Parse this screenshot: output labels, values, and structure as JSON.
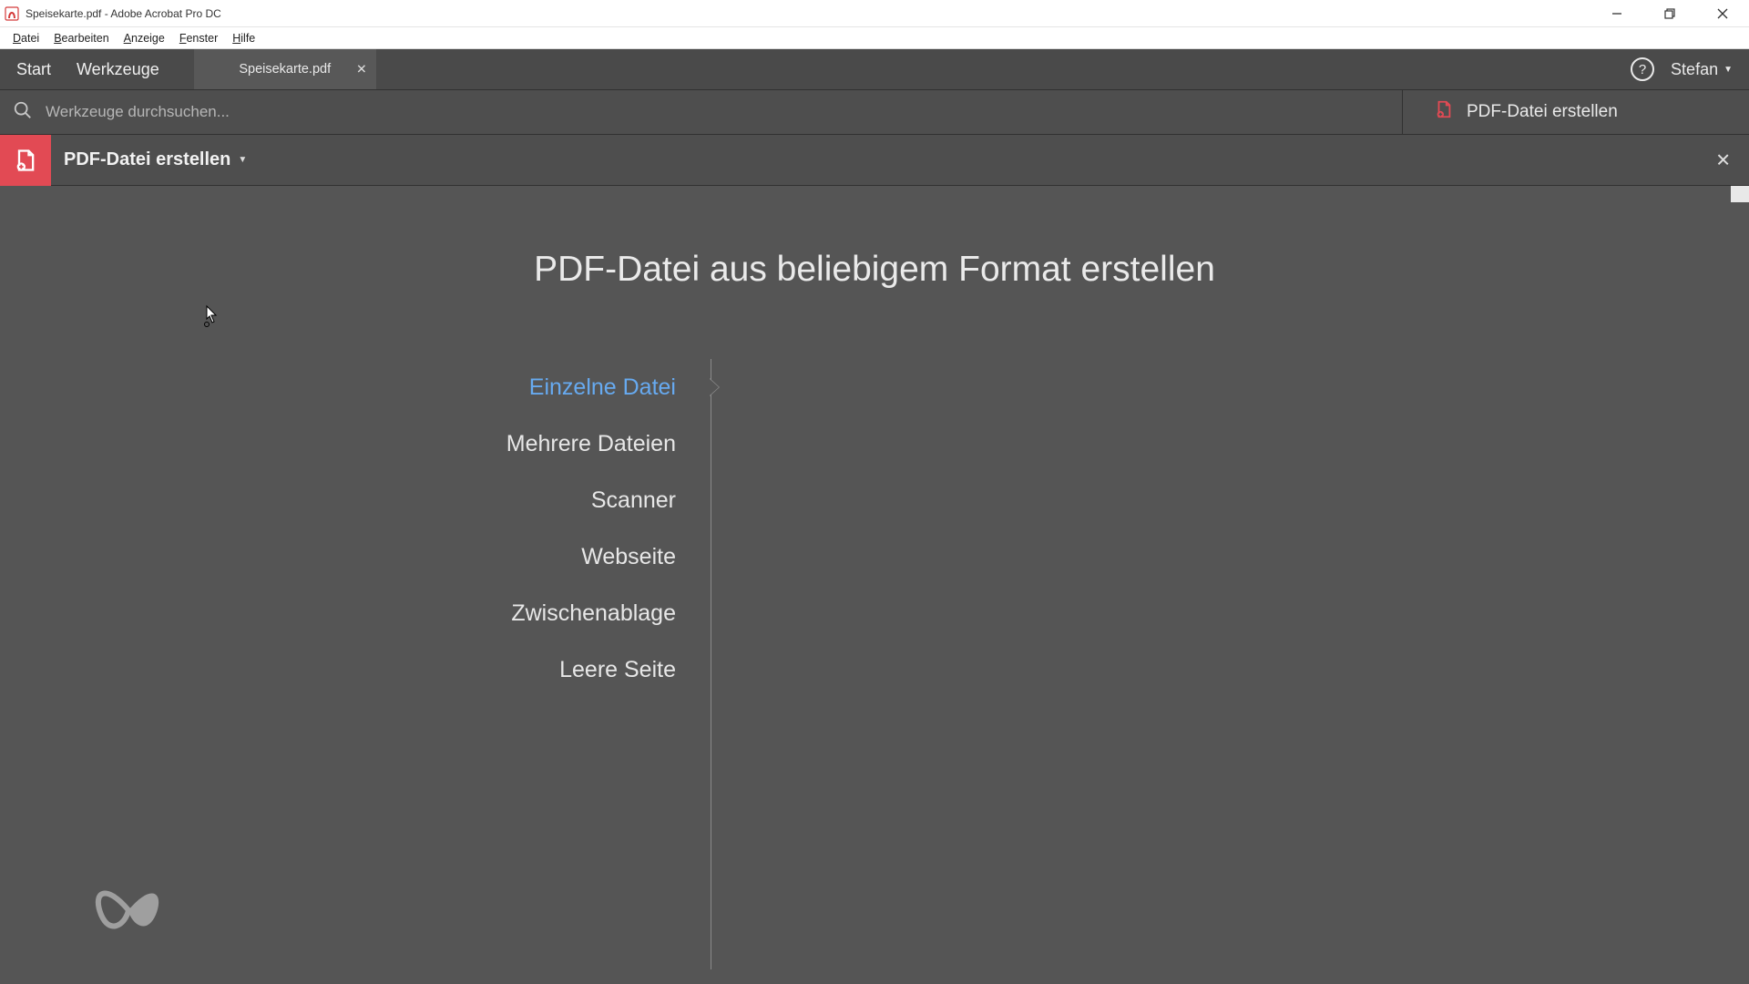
{
  "window": {
    "title": "Speisekarte.pdf - Adobe Acrobat Pro DC"
  },
  "menubar": {
    "items": [
      {
        "label": "Datei",
        "hot": "D"
      },
      {
        "label": "Bearbeiten",
        "hot": "B"
      },
      {
        "label": "Anzeige",
        "hot": "A"
      },
      {
        "label": "Fenster",
        "hot": "F"
      },
      {
        "label": "Hilfe",
        "hot": "H"
      }
    ]
  },
  "nav": {
    "start": "Start",
    "tools": "Werkzeuge",
    "doc_tab": "Speisekarte.pdf",
    "user": "Stefan"
  },
  "search": {
    "placeholder": "Werkzeuge durchsuchen..."
  },
  "right_panel": {
    "title": "PDF-Datei erstellen"
  },
  "tool_header": {
    "title": "PDF-Datei erstellen"
  },
  "page": {
    "title": "PDF-Datei aus beliebigem Format erstellen"
  },
  "options": [
    {
      "label": "Einzelne Datei",
      "selected": true
    },
    {
      "label": "Mehrere Dateien",
      "selected": false
    },
    {
      "label": "Scanner",
      "selected": false
    },
    {
      "label": "Webseite",
      "selected": false
    },
    {
      "label": "Zwischenablage",
      "selected": false
    },
    {
      "label": "Leere Seite",
      "selected": false
    }
  ]
}
